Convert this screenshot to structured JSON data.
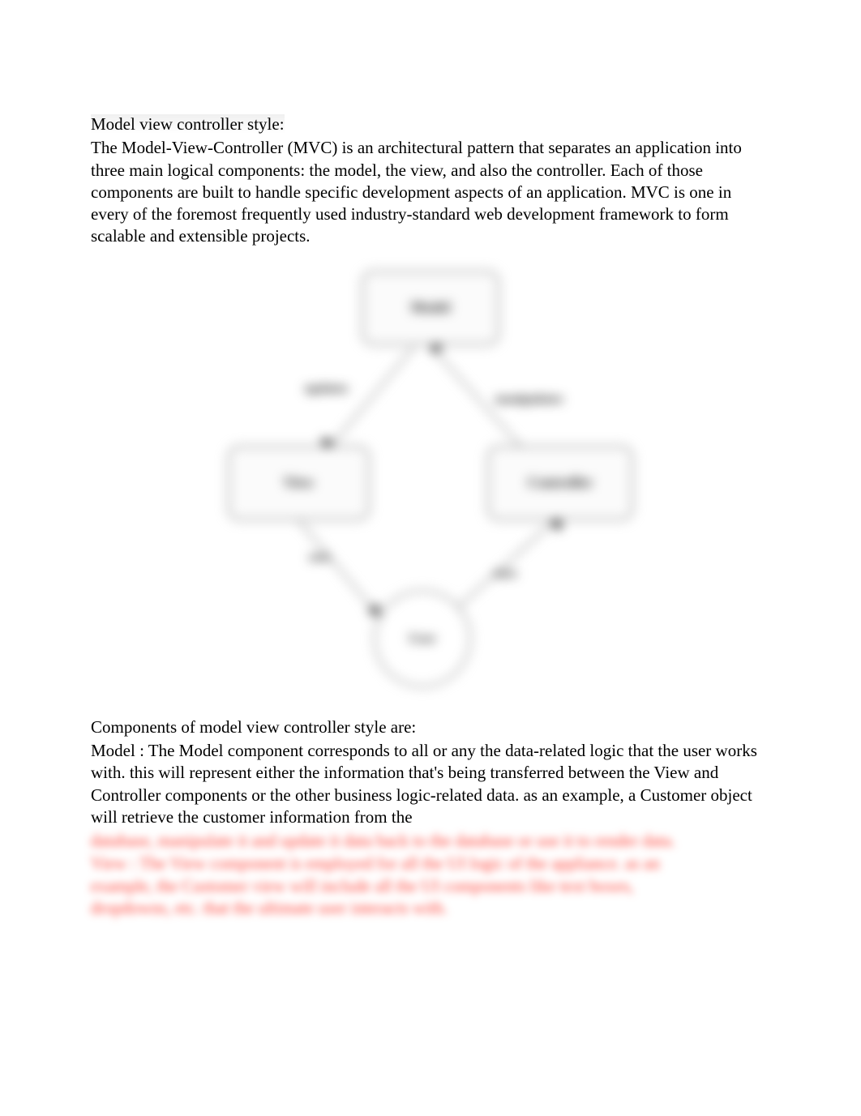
{
  "doc": {
    "heading": "Model view controller style:",
    "intro": "The Model-View-Controller (MVC) is an architectural pattern that separates an application into three main logical components: the model, the view, and also the controller. Each of those components are built to handle specific development aspects of an application. MVC is one in every of the foremost frequently used industry-standard web development framework to form scalable and extensible projects.",
    "section2_heading": "Components of model view controller style are:",
    "model_para": "Model : The Model component corresponds to all or any the data-related logic that the user works with. this will represent either the information that's being transferred between the View and Controller components or the other business logic-related data. as an example, a Customer object will retrieve the customer information from the",
    "blurred_line1": "database, manipulate it and update it data back to the database or use it to render data.",
    "blurred_line2": "View : The View component is employed for all the UI logic of the appliance. as an",
    "blurred_line3": "example, the Customer view will include all the UI components like text boxes,",
    "blurred_line4": "dropdowns, etc. that the ultimate user interacts with."
  },
  "diagram": {
    "model": "Model",
    "view": "View",
    "controller": "Controller",
    "user": "User",
    "edges": {
      "updates": "updates",
      "manipulates": "manipulates",
      "sees": "sees",
      "uses": "uses"
    }
  }
}
